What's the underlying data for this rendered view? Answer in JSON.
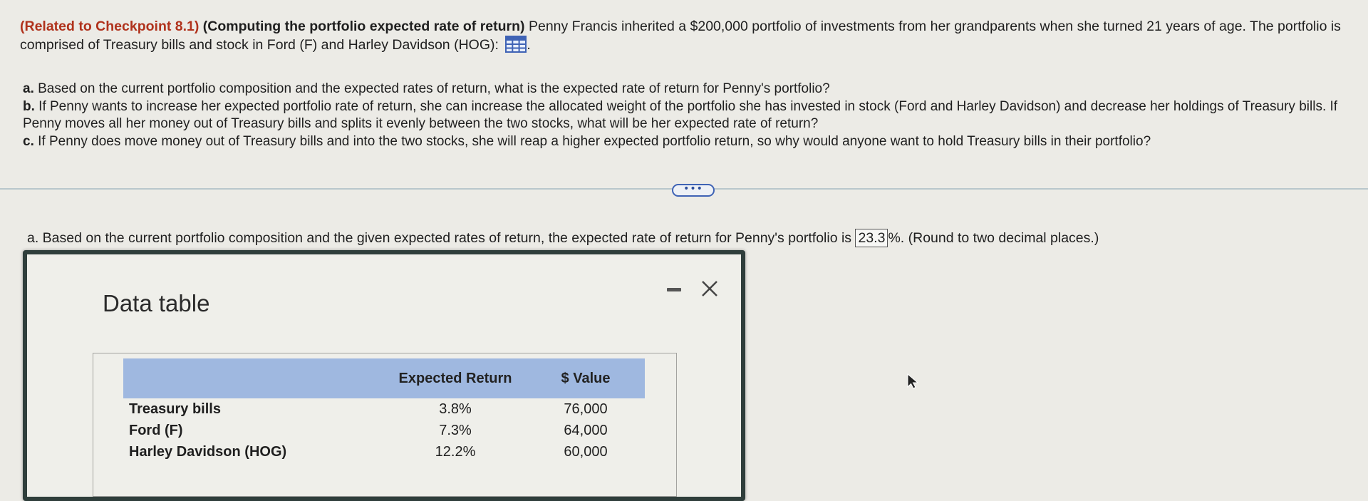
{
  "problem": {
    "reference": "(Related to Checkpoint 8.1)",
    "topic": "(Computing the portfolio expected rate of return)",
    "statement": " Penny Francis inherited a $200,000 portfolio of investments from her grandparents when she turned 21 years of age. The portfolio is comprised of Treasury bills and stock in Ford (F) and Harley Davidson (HOG):",
    "icon": "table-grid-icon",
    "trailing": "."
  },
  "questions": [
    {
      "label": "a.",
      "text": " Based on the current portfolio composition and the expected rates of return, what is the expected rate of return for Penny's portfolio?"
    },
    {
      "label": "b.",
      "text": " If Penny wants to increase her expected portfolio rate of return, she can increase the allocated weight of the portfolio she has invested in stock (Ford and Harley Davidson) and decrease her holdings of Treasury bills. If Penny moves all her money out of Treasury bills and splits it evenly between the two stocks, what will be her expected rate of return?"
    },
    {
      "label": "c.",
      "text": " If Penny does move money out of Treasury bills and into the two stocks, she will reap a higher expected portfolio return, so why would anyone want to hold Treasury bills in their portfolio?"
    }
  ],
  "more_button": "•••",
  "answer": {
    "prefix": "a. Based on the current portfolio composition and the given expected rates of return, the expected rate of return for Penny's portfolio is ",
    "value": "23.3",
    "suffix": "%.  (Round to two decimal places.)"
  },
  "dialog": {
    "title": "Data table",
    "table": {
      "headers": [
        "",
        "Expected Return",
        "$ Value"
      ],
      "rows": [
        {
          "name": "Treasury bills",
          "expected_return": "3.8%",
          "value": "76,000"
        },
        {
          "name": "Ford (F)",
          "expected_return": "7.3%",
          "value": "64,000"
        },
        {
          "name": "Harley Davidson (HOG)",
          "expected_return": "12.2%",
          "value": "60,000"
        }
      ]
    }
  },
  "colors": {
    "reference": "#b0321c",
    "table_header": "#9fb8e0",
    "background": "#ecebe6",
    "accent": "#3f63b5"
  }
}
